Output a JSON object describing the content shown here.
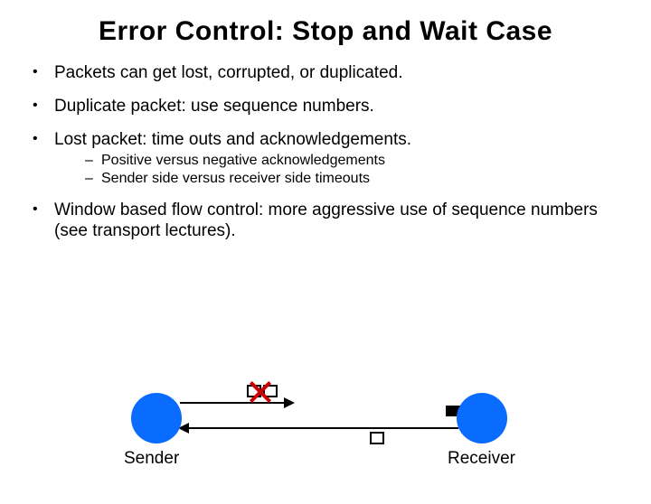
{
  "title": "Error Control: Stop and Wait Case",
  "bullets": [
    {
      "text": "Packets can get lost, corrupted, or duplicated."
    },
    {
      "text": "Duplicate packet: use sequence numbers."
    },
    {
      "text": "Lost packet: time outs and acknowledgements.",
      "sub": [
        "Positive versus negative acknowledgements",
        "Sender side versus receiver side timeouts"
      ]
    },
    {
      "text": "Window based flow control: more aggressive use of sequence numbers (see transport lectures)."
    }
  ],
  "diagram": {
    "sender_label": "Sender",
    "receiver_label": "Receiver"
  }
}
